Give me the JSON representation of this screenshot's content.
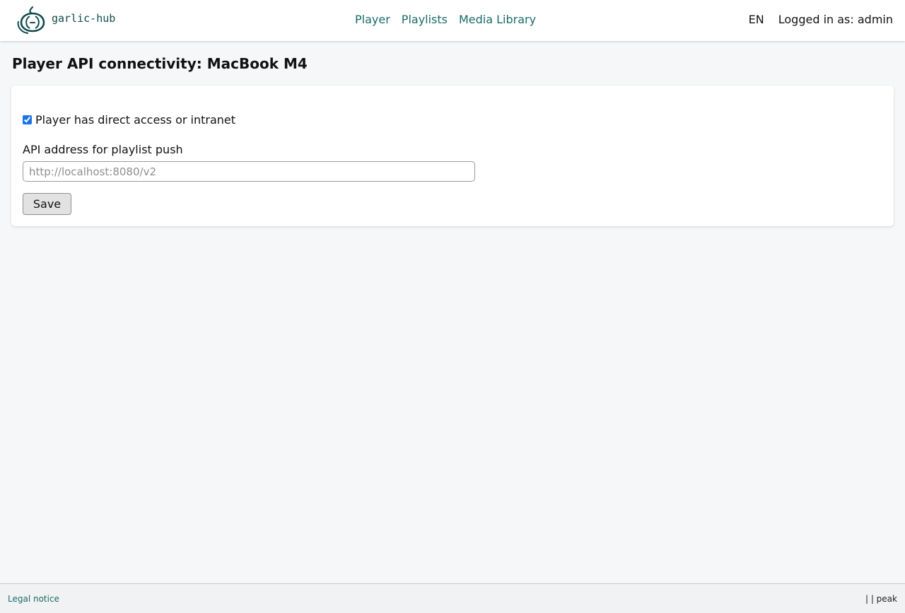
{
  "header": {
    "logo_text": "garlic-hub",
    "nav": [
      "Player",
      "Playlists",
      "Media Library"
    ],
    "language": "EN",
    "user_status": "Logged in as: admin"
  },
  "main": {
    "title": "Player API connectivity: MacBook M4",
    "checkbox": {
      "label": "Player has direct access or intranet",
      "checked": true
    },
    "api_field": {
      "label": "API address for playlist push",
      "placeholder": "http://localhost:8080/v2",
      "value": ""
    },
    "save_label": "Save"
  },
  "footer": {
    "legal": "Legal notice",
    "version": "| | peak"
  },
  "colors": {
    "accent": "#1a6a6a",
    "logo": "#114c4c",
    "background": "#f6f7f8"
  }
}
